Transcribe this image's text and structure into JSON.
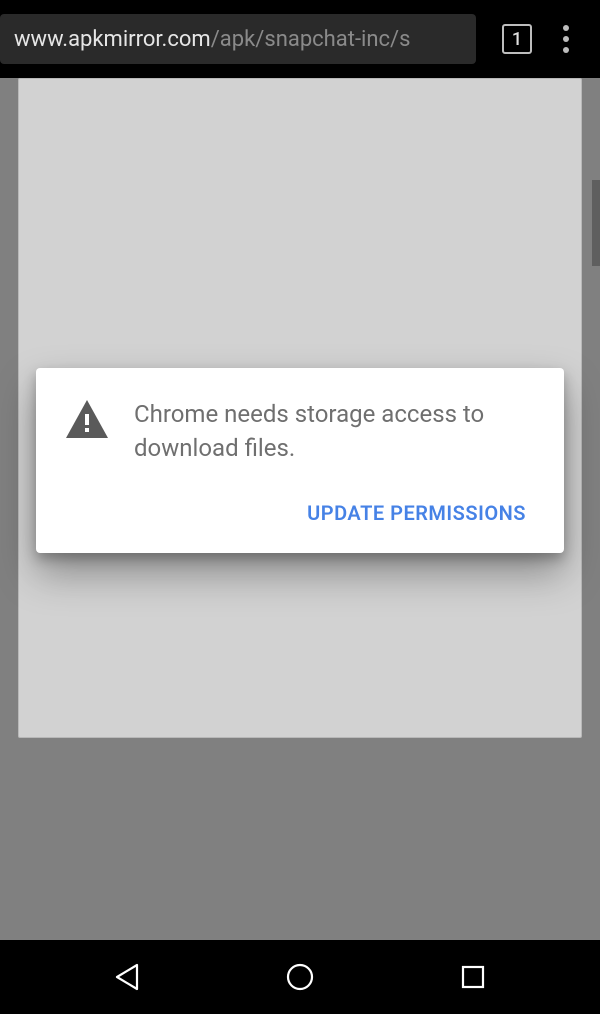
{
  "browser": {
    "url_domain": "www.apkmirror.com",
    "url_path": "/apk/snapchat-inc/s",
    "tab_count": "1"
  },
  "dialog": {
    "message": "Chrome needs storage access to download files.",
    "action_label": "UPDATE PERMISSIONS"
  }
}
